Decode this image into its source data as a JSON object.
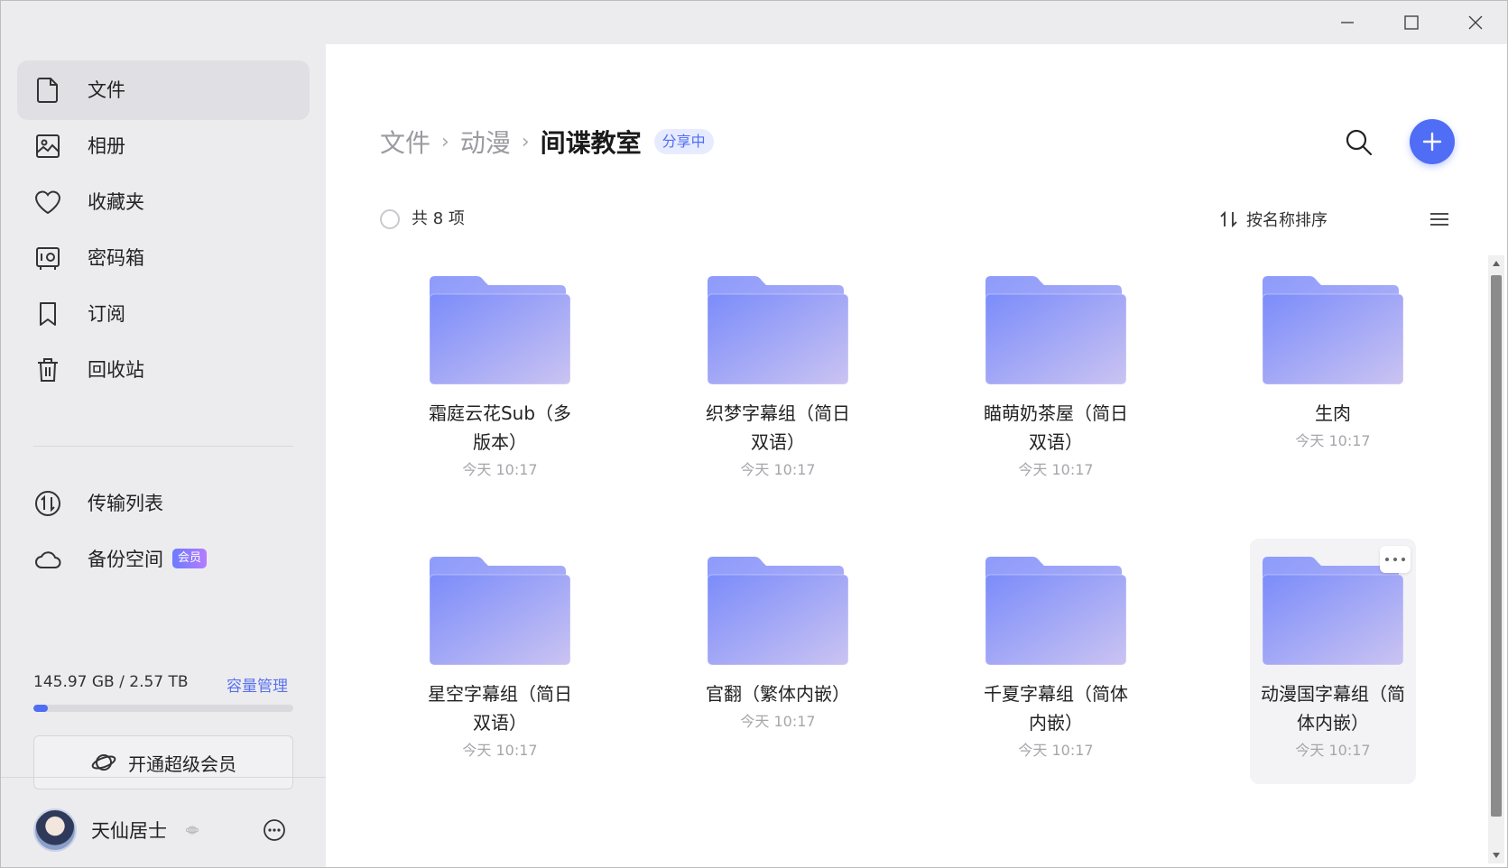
{
  "window": {
    "controls": {
      "minimize": "minimize-icon",
      "maximize": "maximize-icon",
      "close": "close-icon"
    }
  },
  "sidebar": {
    "items": [
      {
        "label": "文件",
        "icon": "file-icon",
        "active": true
      },
      {
        "label": "相册",
        "icon": "photo-album-icon"
      },
      {
        "label": "收藏夹",
        "icon": "heart-icon"
      },
      {
        "label": "密码箱",
        "icon": "safe-box-icon"
      },
      {
        "label": "订阅",
        "icon": "bookmark-icon"
      },
      {
        "label": "回收站",
        "icon": "trash-icon"
      }
    ],
    "secondary_items": [
      {
        "label": "传输列表",
        "icon": "transfer-icon"
      },
      {
        "label": "备份空间",
        "icon": "cloud-icon",
        "badge": "会员"
      }
    ],
    "storage": {
      "used_text": "145.97 GB / 2.57 TB",
      "manage_label": "容量管理",
      "used_fraction": 0.055
    },
    "vip_button": {
      "label": "开通超级会员",
      "icon": "planet-icon"
    },
    "user": {
      "name": "天仙居士",
      "more_icon": "more-circle-icon"
    }
  },
  "main": {
    "breadcrumb": [
      {
        "label": "文件"
      },
      {
        "label": "动漫"
      },
      {
        "label": "间谍教室",
        "current": true
      }
    ],
    "share_badge": "分享中",
    "item_count": "共 8 项",
    "sort_label": "按名称排序",
    "folders": [
      {
        "name_line1": "霜庭云花Sub（多",
        "name_line2": "版本）",
        "time": "今天 10:17"
      },
      {
        "name_line1": "织梦字幕组（简日",
        "name_line2": "双语）",
        "time": "今天 10:17"
      },
      {
        "name_line1": "瞄萌奶茶屋（简日",
        "name_line2": "双语）",
        "time": "今天 10:17"
      },
      {
        "name_line1": "生肉",
        "name_line2": "",
        "time": "今天 10:17"
      },
      {
        "name_line1": "星空字幕组（简日",
        "name_line2": "双语）",
        "time": "今天 10:17"
      },
      {
        "name_line1": "官翻（繁体内嵌）",
        "name_line2": "",
        "time": "今天 10:17"
      },
      {
        "name_line1": "千夏字幕组（简体",
        "name_line2": "内嵌）",
        "time": "今天 10:17"
      },
      {
        "name_line1": "动漫国字幕组（简",
        "name_line2": "体内嵌）",
        "time": "今天 10:17",
        "hovered": true
      }
    ],
    "colors": {
      "accent": "#4f6df5",
      "folder_start": "#7d8ffb",
      "folder_end": "#c8c3f3"
    }
  }
}
